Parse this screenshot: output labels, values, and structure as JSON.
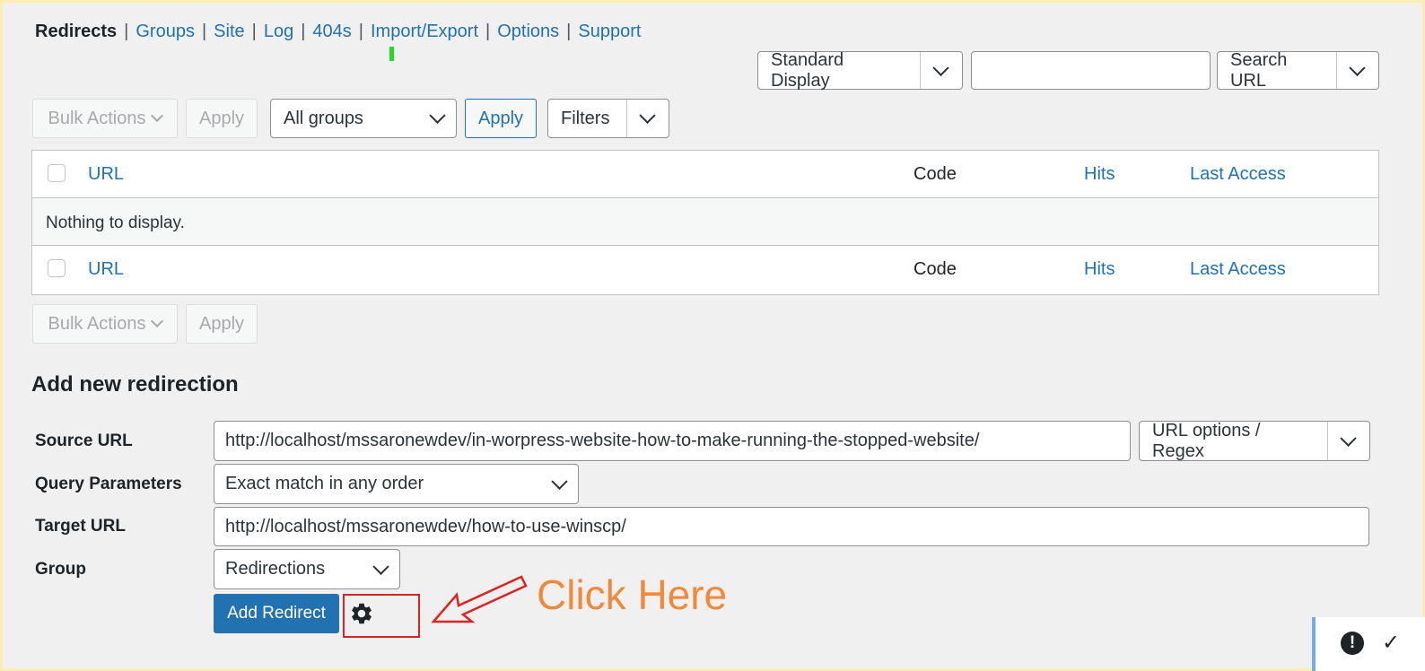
{
  "subnav": {
    "current": "Redirects",
    "links": [
      "Groups",
      "Site",
      "Log",
      "404s",
      "Import/Export",
      "Options",
      "Support"
    ],
    "separator": "|"
  },
  "search": {
    "display_mode": "Standard Display",
    "search_value": "",
    "search_type": "Search URL"
  },
  "toolbar": {
    "bulk_actions": "Bulk Actions",
    "apply": "Apply",
    "groups_filter": "All groups",
    "filters": "Filters"
  },
  "table": {
    "columns": [
      "URL",
      "Code",
      "Hits",
      "Last Access"
    ],
    "empty_message": "Nothing to display."
  },
  "add_form": {
    "title": "Add new redirection",
    "source_label": "Source URL",
    "source_value": "http://localhost/mssaronewdev/in-worpress-website-how-to-make-running-the-stopped-website/",
    "url_options": "URL options / Regex",
    "query_label": "Query Parameters",
    "query_value": "Exact match in any order",
    "target_label": "Target URL",
    "target_value": "http://localhost/mssaronewdev/how-to-use-winscp/",
    "group_label": "Group",
    "group_value": "Redirections",
    "submit": "Add Redirect"
  },
  "annotation": {
    "text": "Click Here",
    "color": "#f08a3a",
    "box_color": "#dd2222"
  },
  "notice": {
    "icon": "exclamation",
    "check": "✓"
  },
  "icons": {
    "gear": "gear-icon"
  },
  "colors": {
    "link": "#2271b1",
    "primary": "#2271b1",
    "background": "#f0f0f1"
  }
}
